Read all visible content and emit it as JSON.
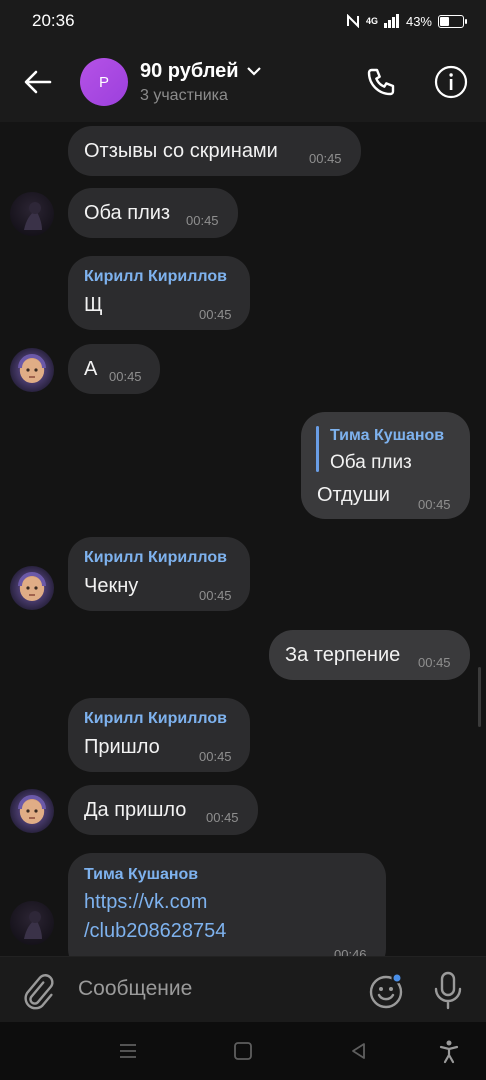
{
  "status_bar": {
    "time": "20:36",
    "network": "4G",
    "battery": "43%",
    "battery_level": 0.43
  },
  "header": {
    "back_icon": "arrow-left-icon",
    "avatar_letter": "P",
    "title": "90 рублей",
    "subtitle": "3 участника",
    "call_icon": "phone-icon",
    "info_icon": "info-icon"
  },
  "messages": [
    {
      "text": "Отзывы со скринами",
      "time": "00:45"
    },
    {
      "text": "Оба плиз",
      "time": "00:45"
    },
    {
      "sender": "Кирилл Кириллов",
      "text": "Щ",
      "time": "00:45"
    },
    {
      "text": "А",
      "time": "00:45"
    },
    {
      "reply_sender": "Тима Кушанов",
      "reply_text": "Оба плиз",
      "text": "Отдуши",
      "time": "00:45"
    },
    {
      "sender": "Кирилл Кириллов",
      "text": "Чекну",
      "time": "00:45"
    },
    {
      "text": "За терпение",
      "time": "00:45"
    },
    {
      "sender": "Кирилл Кириллов",
      "text": "Пришло",
      "time": "00:45"
    },
    {
      "text": "Да пришло",
      "time": "00:45"
    },
    {
      "sender": "Тима Кушанов",
      "link_line1": "https://vk.com",
      "link_line2": "/club208628754",
      "time": "00:46"
    }
  ],
  "input": {
    "placeholder": "Сообщение"
  }
}
